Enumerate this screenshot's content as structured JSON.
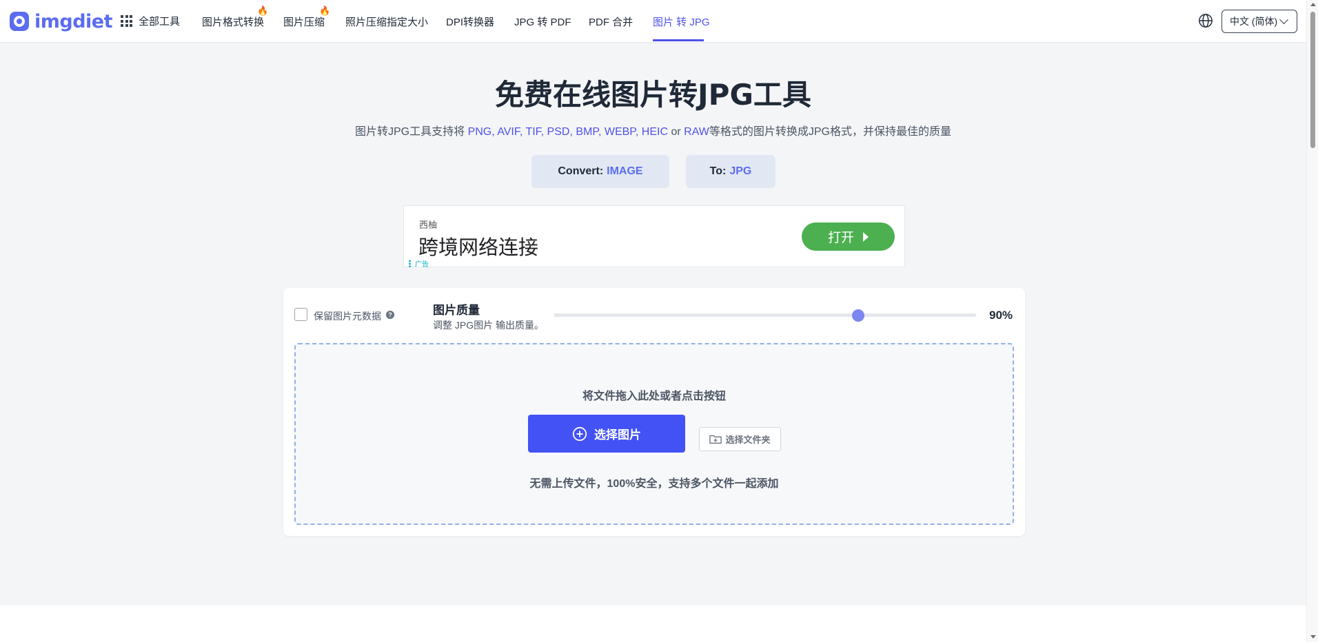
{
  "brand": {
    "logo_text": "imgdiet"
  },
  "nav": {
    "all_tools": "全部工具",
    "items": [
      {
        "label": "图片格式转换",
        "hot": true
      },
      {
        "label": "图片压缩",
        "hot": true
      },
      {
        "label": "照片压缩指定大小",
        "hot": false
      },
      {
        "label": "DPI转换器",
        "hot": false
      },
      {
        "label": "JPG 转 PDF",
        "hot": false
      },
      {
        "label": "PDF 合并",
        "hot": false
      },
      {
        "label": "图片 转 JPG",
        "hot": false,
        "active": true
      }
    ],
    "hot_icon": "fire-icon"
  },
  "language": {
    "selected": "中文 (简体)"
  },
  "hero": {
    "title": "免费在线图片转JPG工具",
    "subtitle_prefix": "图片转JPG工具支持将 ",
    "subtitle_formats": "PNG, AVIF, TIF, PSD, BMP, WEBP, HEIC",
    "subtitle_or": " or ",
    "subtitle_raw": "RAW",
    "subtitle_suffix": "等格式的图片转换成JPG格式，并保持最佳的质量"
  },
  "convert": {
    "from_label": "Convert:",
    "from_value": "IMAGE",
    "to_label": "To:",
    "to_value": "JPG"
  },
  "ad": {
    "brand": "西柚",
    "headline": "跨境网络连接",
    "button": "打开",
    "label": "广告"
  },
  "options": {
    "keep_metadata_label": "保留图片元数据",
    "keep_metadata_checked": false,
    "help_glyph": "?",
    "quality_title": "图片质量",
    "quality_desc": "调整 JPG图片 输出质量。",
    "quality_value": 90,
    "quality_text": "90%"
  },
  "dropzone": {
    "hint": "将文件拖入此处或者点击按钮",
    "select_button": "选择图片",
    "folder_button": "选择文件夹",
    "safety_note": "无需上传文件，100%安全，支持多个文件一起添加"
  },
  "colors": {
    "accent": "#4f52e6",
    "primary_button": "#4252f5",
    "ad_button": "#4caf50",
    "page_bg": "#f4f5f7"
  }
}
